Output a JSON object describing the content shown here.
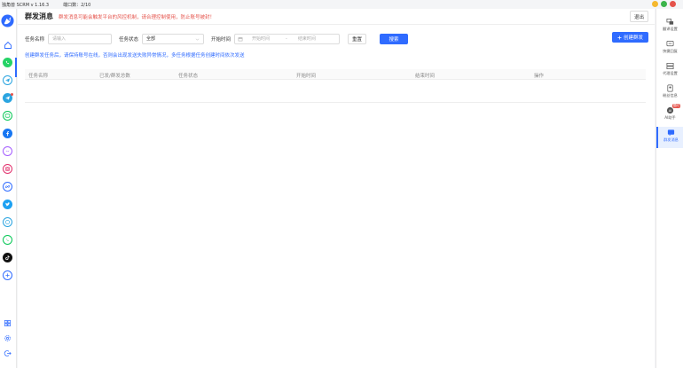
{
  "titlebar": {
    "app_title": "独角兽 SCRM v 1.16.3",
    "ports": "端口数：2/10"
  },
  "header": {
    "page_title": "群发消息",
    "warning": "群发消息可能会触发平台的风控机制，请合理控制使用，防止账号被封！",
    "exit_label": "退出"
  },
  "filters": {
    "task_name_label": "任务名称",
    "task_name_placeholder": "请输入",
    "task_status_label": "任务状态",
    "task_status_value": "全部",
    "start_time_label": "开始时间",
    "start_date_placeholder": "开始时间",
    "end_date_placeholder": "结束时间",
    "range_separator": "-",
    "reset_label": "重置",
    "search_label": "搜索",
    "create_label": "创建群发"
  },
  "tip": "创建群发任务后，请保持账号在线，否则会出现发送失败异常情况，多任务根据任务创建时间依次发送",
  "table": {
    "columns": [
      "任务名称",
      "已发/群发总数",
      "任务状态",
      "开始时间",
      "结束时间",
      "操作"
    ]
  },
  "rightbar": {
    "items": [
      {
        "label": "翻译设置",
        "icon": "translate-icon"
      },
      {
        "label": "快捷回复",
        "icon": "quick-reply-icon"
      },
      {
        "label": "代理设置",
        "icon": "proxy-icon"
      },
      {
        "label": "粉丝信息",
        "icon": "fan-info-icon"
      },
      {
        "label": "AI助手",
        "icon": "ai-assistant-icon",
        "badge": "限时"
      },
      {
        "label": "群发消息",
        "icon": "mass-message-icon",
        "active": true
      }
    ]
  },
  "colors": {
    "accent": "#2f6bff",
    "warning": "#e5534b",
    "whatsapp": "#25d366",
    "telegram": "#2aa4e0",
    "facebook": "#1877f2",
    "messenger": "#a45cff",
    "instagram": "#e1306c",
    "twitter": "#1da1f2",
    "line": "#06c755"
  }
}
